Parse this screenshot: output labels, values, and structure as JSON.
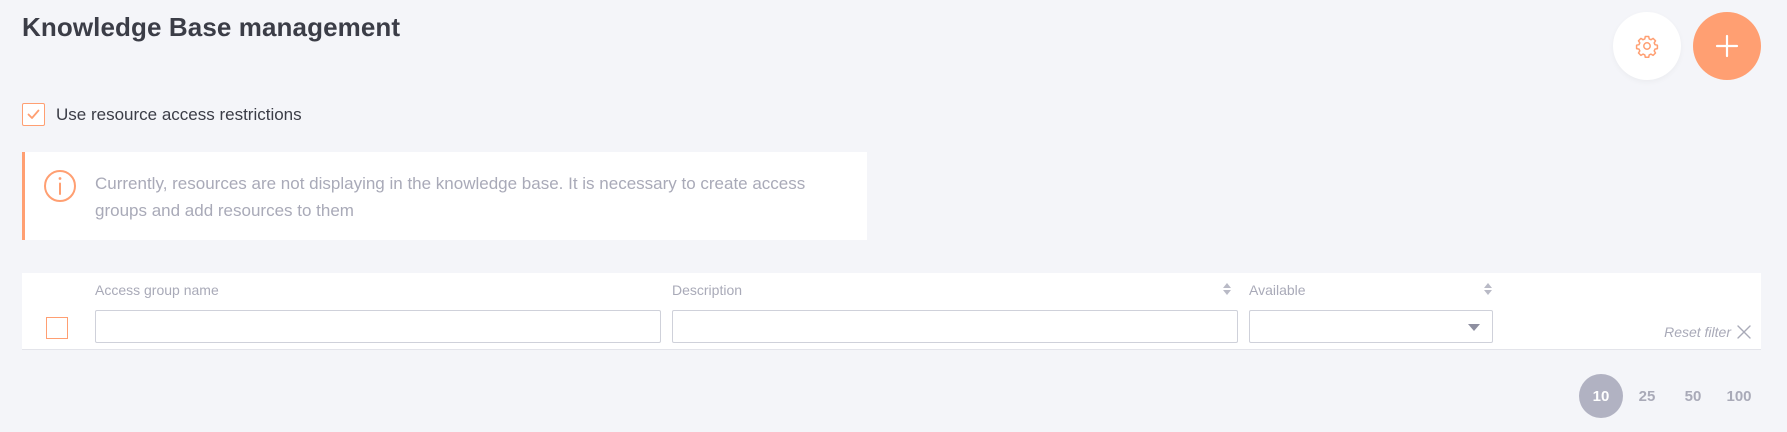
{
  "header": {
    "title": "Knowledge Base management",
    "settings_icon": "gear-icon",
    "add_icon": "plus-icon"
  },
  "restrictions": {
    "checked": true,
    "label": "Use resource access restrictions"
  },
  "notice": {
    "icon": "info-icon",
    "text": "Currently, resources are not displaying in the knowledge base. It is necessary to create access groups and add resources to them"
  },
  "filters": {
    "columns": [
      {
        "label": "Access group name",
        "value": "",
        "sortable": false
      },
      {
        "label": "Description",
        "value": "",
        "sortable": true
      },
      {
        "label": "Available",
        "value": "",
        "sortable": true
      }
    ],
    "reset_label": "Reset filter"
  },
  "pagination": {
    "sizes": [
      "10",
      "25",
      "50",
      "100"
    ],
    "selected": "10"
  },
  "colors": {
    "accent": "#ff9f72",
    "background": "#f4f5f9",
    "muted_text": "#a9aab8",
    "selected_page_bg": "#b1b2c2"
  }
}
